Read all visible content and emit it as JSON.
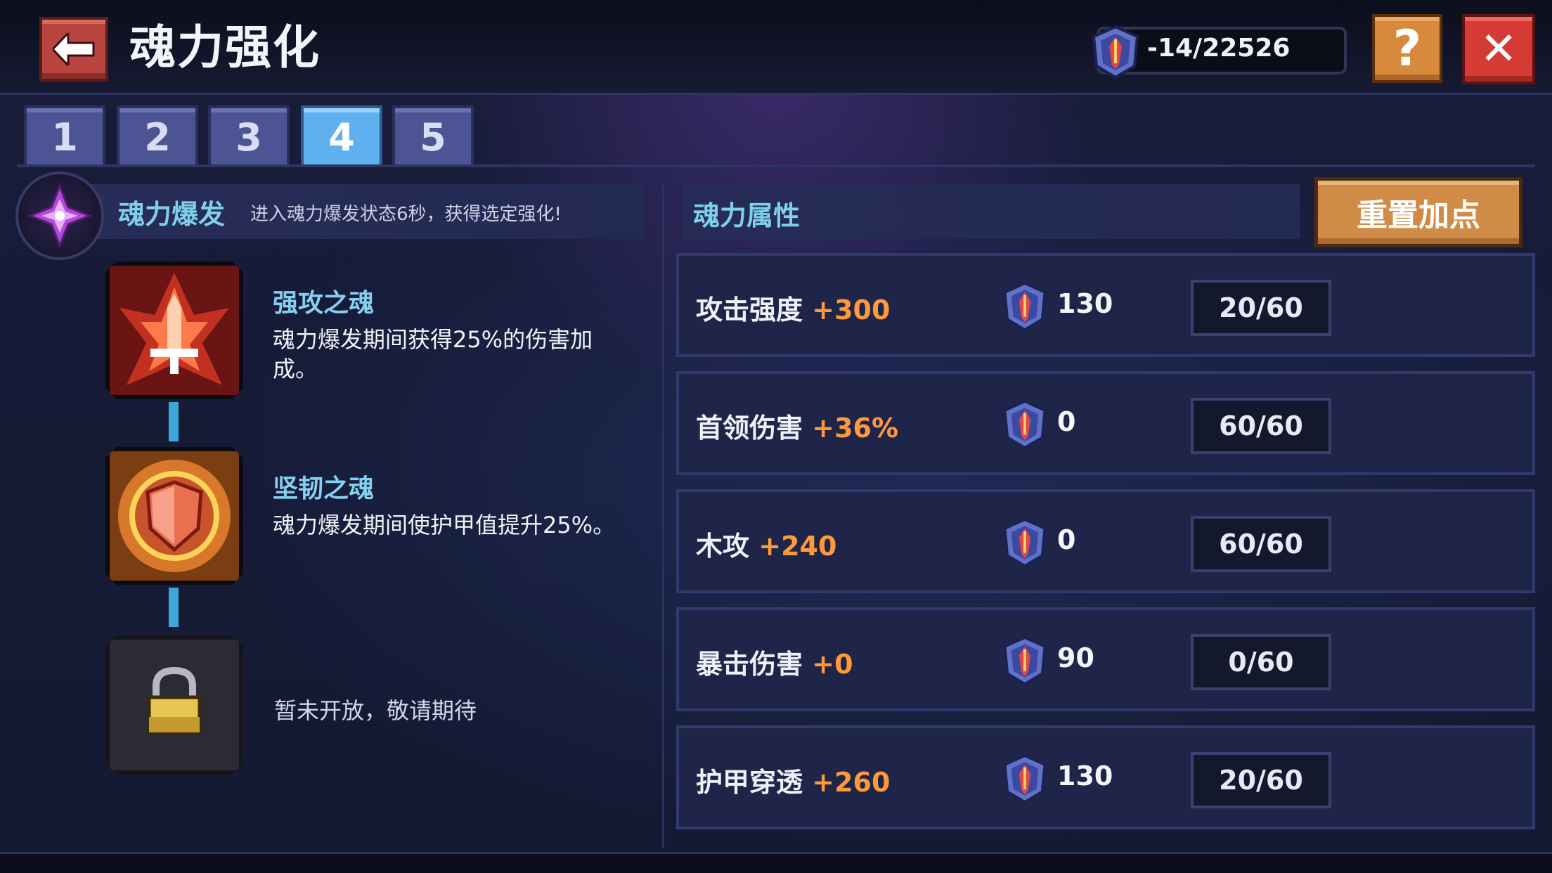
{
  "header": {
    "title": "魂力强化",
    "currency": "-14/22526",
    "help_label": "?",
    "close_label": "✕"
  },
  "tabs": [
    {
      "label": "1"
    },
    {
      "label": "2"
    },
    {
      "label": "3"
    },
    {
      "label": "4",
      "active": true
    },
    {
      "label": "5"
    }
  ],
  "burst": {
    "title": "魂力爆发",
    "desc": "进入魂力爆发状态6秒，获得选定强化!"
  },
  "skills": [
    {
      "name": "强攻之魂",
      "desc": "魂力爆发期间获得25%的伤害加成。",
      "icon": "flame-sword-icon"
    },
    {
      "name": "坚韧之魂",
      "desc": "魂力爆发期间使护甲值提升25%。",
      "icon": "shield-icon"
    },
    {
      "locked_text": "暂未开放，敬请期待",
      "icon": "lock-icon"
    }
  ],
  "attributes": {
    "title": "魂力属性",
    "reset_label": "重置加点",
    "rows": [
      {
        "name": "攻击强度",
        "bonus": "+300",
        "cost": "130",
        "level": "20/60"
      },
      {
        "name": "首领伤害",
        "bonus": "+36%",
        "cost": "0",
        "level": "60/60"
      },
      {
        "name": "木攻",
        "bonus": "+240",
        "cost": "0",
        "level": "60/60"
      },
      {
        "name": "暴击伤害",
        "bonus": "+0",
        "cost": "90",
        "level": "0/60"
      },
      {
        "name": "护甲穿透",
        "bonus": "+260",
        "cost": "130",
        "level": "20/60"
      }
    ]
  },
  "colors": {
    "accent_cyan": "#7fd0ea",
    "bonus_orange": "#ff9a3c",
    "active_tab": "#5fb0ef"
  }
}
